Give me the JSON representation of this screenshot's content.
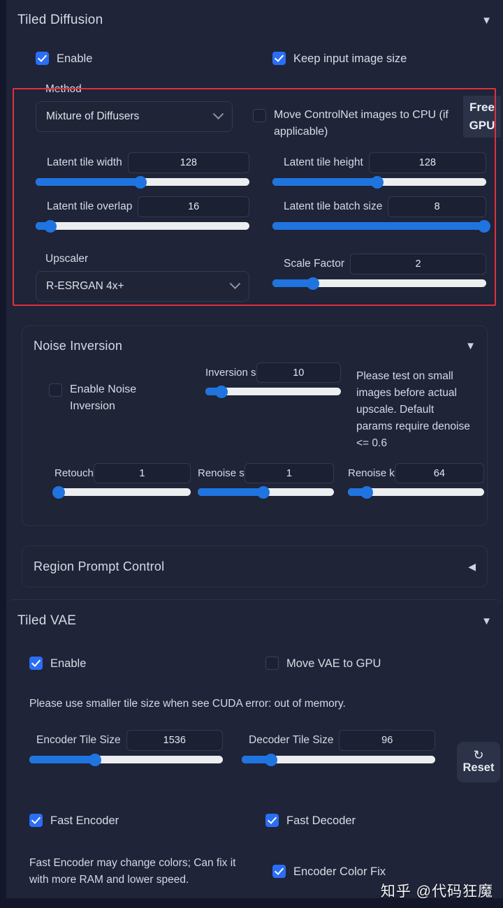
{
  "tiled_diffusion": {
    "title": "Tiled Diffusion",
    "caret": "▼",
    "enable_label": "Enable",
    "keep_input_label": "Keep input image size",
    "method_label": "Method",
    "method_value": "Mixture of Diffusers",
    "move_cn_label": "Move ControlNet images to CPU (if applicable)",
    "free_gpu_line1": "Free",
    "free_gpu_line2": "GPU",
    "sliders": [
      {
        "label": "Latent tile width",
        "value": "128",
        "pct": 49
      },
      {
        "label": "Latent tile height",
        "value": "128",
        "pct": 49
      },
      {
        "label": "Latent tile overlap",
        "value": "16",
        "pct": 7
      },
      {
        "label": "Latent tile batch size",
        "value": "8",
        "pct": 99
      }
    ],
    "upscaler_label": "Upscaler",
    "upscaler_value": "R-ESRGAN 4x+",
    "scale_factor": {
      "label": "Scale Factor",
      "value": "2",
      "pct": 19
    }
  },
  "noise_inversion": {
    "title": "Noise Inversion",
    "caret": "▼",
    "enable_label": "Enable Noise Inversion",
    "inversion_steps": {
      "label": "Inversion s",
      "value": "10",
      "pct": 12
    },
    "hint": "Please test on small images before actual upscale. Default params require denoise <= 0.6",
    "bottom_sliders": [
      {
        "label": "Retouch",
        "value": "1",
        "pct": 3
      },
      {
        "label": "Renoise s",
        "value": "1",
        "pct": 48
      },
      {
        "label": "Renoise k",
        "value": "64",
        "pct": 14
      }
    ]
  },
  "region_prompt_control": {
    "title": "Region Prompt Control",
    "caret": "◀"
  },
  "tiled_vae": {
    "title": "Tiled VAE",
    "caret": "▼",
    "enable_label": "Enable",
    "move_vae_label": "Move VAE to GPU",
    "cuda_hint": "Please use smaller tile size when see CUDA error: out of memory.",
    "encoder_tile": {
      "label": "Encoder Tile Size",
      "value": "1536",
      "pct": 34
    },
    "decoder_tile": {
      "label": "Decoder Tile Size",
      "value": "96",
      "pct": 15
    },
    "reset_icon": "↻",
    "reset_label": "Reset",
    "fast_encoder_label": "Fast Encoder",
    "fast_decoder_label": "Fast Decoder",
    "encoder_color_fix_label": "Encoder Color Fix",
    "fast_encoder_hint": "Fast Encoder may change colors; Can fix it with more RAM and lower speed."
  },
  "watermark": "知乎 @代码狂魔",
  "colors": {
    "accent": "#1f74e0",
    "checkbox_on": "#2b6ef6",
    "highlight_border": "#e0313b",
    "panel_bg": "#1f2437",
    "page_bg": "#16192b"
  }
}
